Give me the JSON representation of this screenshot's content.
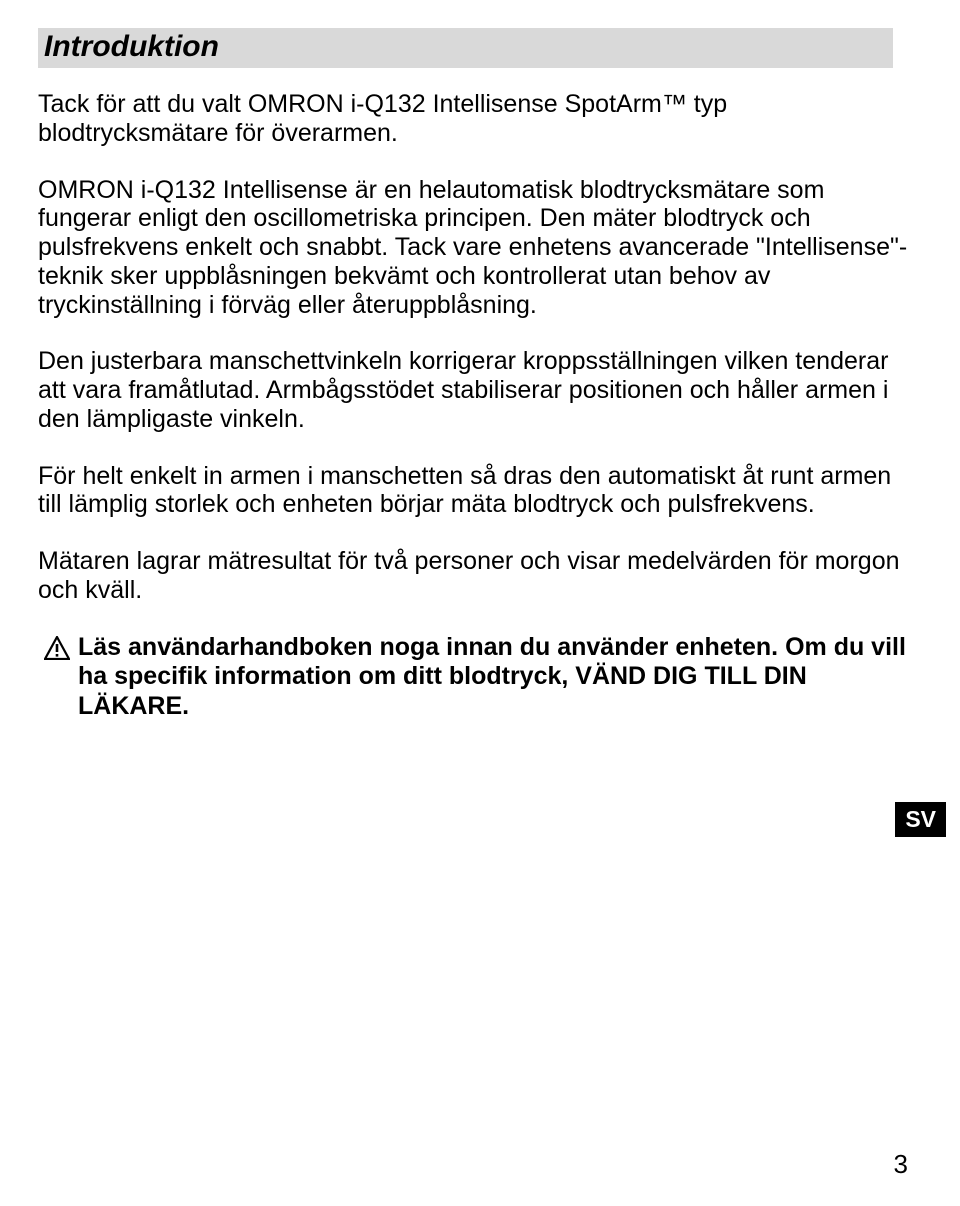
{
  "heading": "Introduktion",
  "p1": "Tack för att du valt OMRON i-Q132 Intellisense SpotArm™ typ blodtrycksmätare för överarmen.",
  "p2": "OMRON i-Q132 Intellisense är en helautomatisk blodtrycksmätare som fungerar enligt den oscillometriska principen. Den mäter blodtryck och pulsfrekvens enkelt och snabbt. Tack vare enhetens avancerade \"Intellisense\"-teknik sker uppblåsningen bekvämt och kontrollerat utan behov av tryckinställning i förväg eller återuppblåsning.",
  "p3": "Den justerbara manschettvinkeln korrigerar kroppsställningen vilken tenderar att vara framåtlutad. Armbågsstödet stabiliserar positionen och håller armen i den lämpligaste vinkeln.",
  "p4": "För helt enkelt in armen i manschetten så dras den automatiskt åt runt armen till lämplig storlek och enheten börjar mäta blodtryck och pulsfrekvens.",
  "p5": "Mätaren lagrar mätresultat för två personer och visar medelvärden för morgon och kväll.",
  "caution": "Läs användarhandboken noga innan du använder enheten. Om du vill ha specifik information om ditt blodtryck, VÄND DIG TILL DIN LÄKARE.",
  "side_tab": "SV",
  "page_number": "3"
}
